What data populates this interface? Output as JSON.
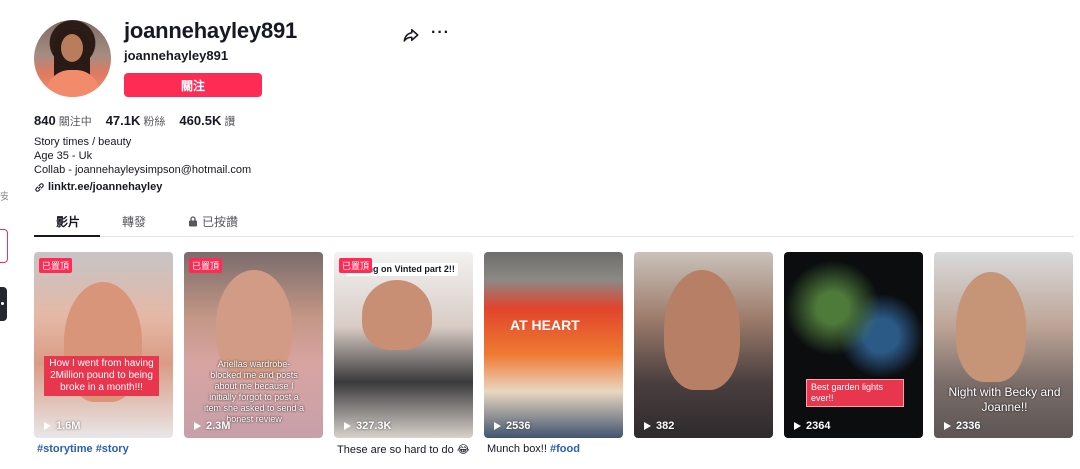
{
  "profile": {
    "username": "joannehayley891",
    "nickname": "joannehayley891",
    "follow_label": "關注"
  },
  "stats": [
    {
      "value": "840",
      "label": "關注中"
    },
    {
      "value": "47.1K",
      "label": "粉絲"
    },
    {
      "value": "460.5K",
      "label": "讚"
    }
  ],
  "bio": {
    "line1": "Story times / beauty",
    "line2": "Age 35 - Uk",
    "line3": "Collab - joannehayleysimpson@hotmail.com",
    "link": "linktr.ee/joannehayley"
  },
  "tabs": [
    {
      "label": "影片"
    },
    {
      "label": "轉發"
    },
    {
      "label": "已按讚"
    }
  ],
  "videos": [
    {
      "pinned": "已置頂",
      "views": "1.6M",
      "overlay": "How I went from having 2Million pound to being broke in a month!!!",
      "caption": "#storytime #story"
    },
    {
      "pinned": "已置頂",
      "views": "2.3M",
      "overlay": "Ariellas wardrobe- blocked me and posts about me because I initially forgot to post a item she asked to send a honest review",
      "caption": ""
    },
    {
      "pinned": "已置頂",
      "views": "327.3K",
      "overlay": "Selling on Vinted part 2!!",
      "caption": "These are so hard to do 😂"
    },
    {
      "views": "2536",
      "overlay": "AT HEART",
      "caption": "Munch box!! #food"
    },
    {
      "views": "382",
      "caption": ""
    },
    {
      "views": "2364",
      "overlay": "Best garden lights ever!!",
      "caption": ""
    },
    {
      "views": "2336",
      "overlay": "Night with Becky and Joanne!!",
      "caption": ""
    }
  ],
  "colors": {
    "accent": "#fe2c55",
    "link_tag": "#2b5db9"
  }
}
